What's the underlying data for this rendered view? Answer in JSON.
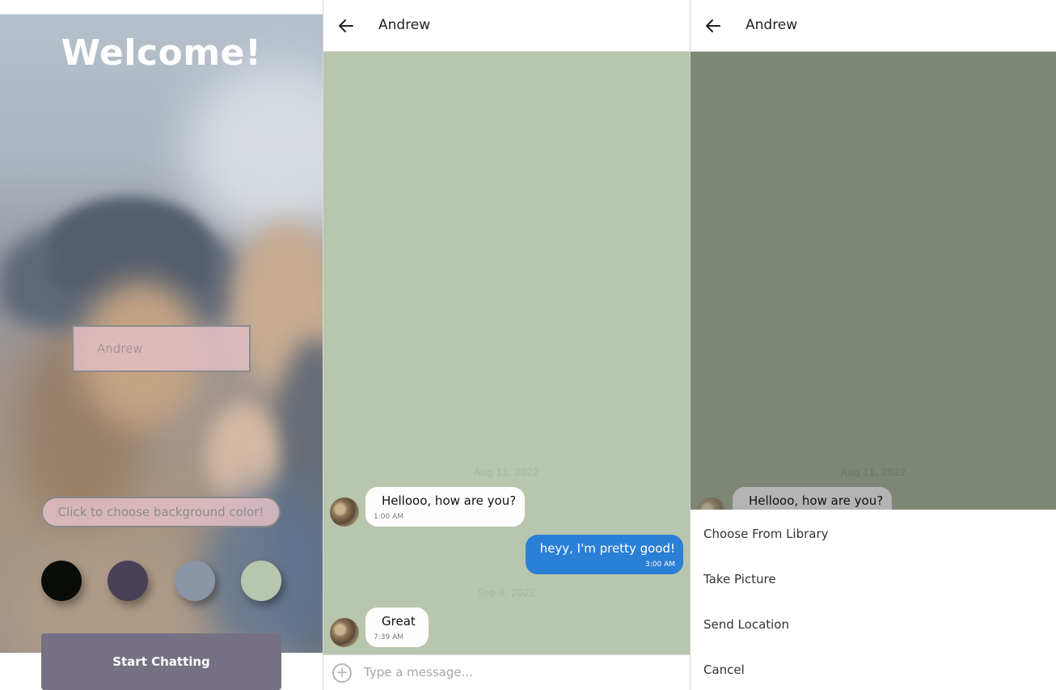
{
  "welcome": {
    "title": "Welcome!",
    "name_value": "Andrew",
    "color_prompt": "Click to choose background color!",
    "swatches": [
      "#090c08",
      "#474056",
      "#8a95a5",
      "#b9c6ae"
    ],
    "start_label": "Start Chatting"
  },
  "chat": {
    "title": "Andrew",
    "background": "#b9c6ae",
    "messages": [
      {
        "date": "Aug 11, 2022"
      },
      {
        "side": "left",
        "text": "Hellooo, how are you?",
        "time": "1:00 AM"
      },
      {
        "side": "right",
        "text": "heyy, I'm pretty good!",
        "time": "3:00 AM"
      },
      {
        "date": "Sep 6, 2022"
      },
      {
        "side": "left",
        "text": "Great",
        "time": "7:39 AM"
      }
    ],
    "input_placeholder": "Type a message..."
  },
  "chat_actions": {
    "title": "Andrew",
    "date": "Aug 11, 2022",
    "message_text": "Hellooo, how are you?",
    "options": [
      "Choose From Library",
      "Take Picture",
      "Send Location",
      "Cancel"
    ]
  },
  "icons": {
    "back": "arrow-left-icon",
    "plus": "plus-circle-icon",
    "avatar": "user-avatar"
  },
  "colors": {
    "accent_bubble": "#2a7fd6",
    "start_button": "#757083",
    "overlay_chat_bg": "#7e8676"
  }
}
